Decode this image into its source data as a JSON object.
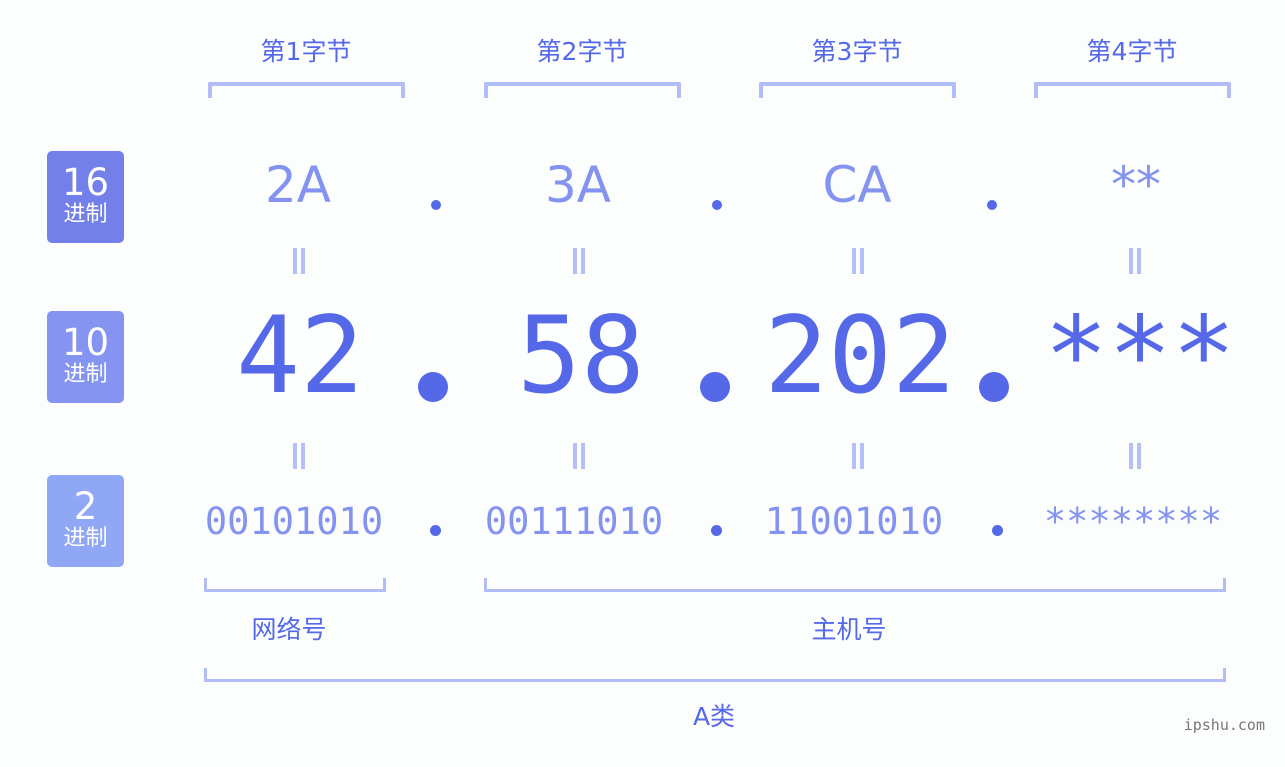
{
  "columns": [
    "第1字节",
    "第2字节",
    "第3字节",
    "第4字节"
  ],
  "badges": {
    "hex": {
      "num": "16",
      "sub": "进制",
      "color": "#7480ea"
    },
    "dec": {
      "num": "10",
      "sub": "进制",
      "color": "#8494f0"
    },
    "bin": {
      "num": "2",
      "sub": "进制",
      "color": "#8fa7f5"
    }
  },
  "hex": [
    "2A",
    "3A",
    "CA",
    "**"
  ],
  "dec": [
    "42",
    "58",
    "202",
    "***"
  ],
  "bin": [
    "00101010",
    "00111010",
    "11001010",
    "********"
  ],
  "separator": ".",
  "equals": "=",
  "network_label": "网络号",
  "host_label": "主机号",
  "class_label": "A类",
  "watermark": "ipshu.com",
  "colors": {
    "primary": "#5468e8",
    "light": "#8493ef",
    "bracket": "#b2bcf7"
  }
}
